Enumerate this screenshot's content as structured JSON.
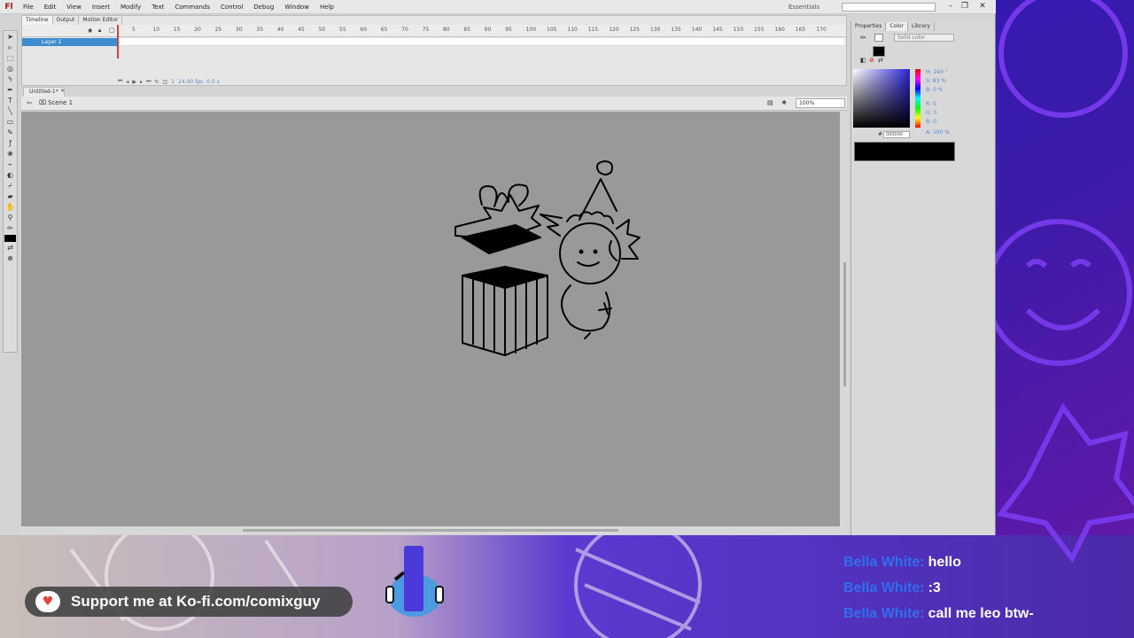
{
  "app": {
    "logo": "Fl",
    "menu": [
      "File",
      "Edit",
      "View",
      "Insert",
      "Modify",
      "Text",
      "Commands",
      "Control",
      "Debug",
      "Window",
      "Help"
    ],
    "workspace": "Essentials",
    "window_controls": [
      "–",
      "❐",
      "✕"
    ]
  },
  "timeline": {
    "tabs": [
      "Timeline",
      "Output",
      "Motion Editor"
    ],
    "frame_numbers": [
      "5",
      "10",
      "15",
      "20",
      "25",
      "30",
      "35",
      "40",
      "45",
      "50",
      "55",
      "60",
      "65",
      "70",
      "75",
      "80",
      "85",
      "90",
      "95",
      "100",
      "105",
      "110",
      "115",
      "120",
      "125",
      "130",
      "135",
      "140",
      "145",
      "150",
      "155",
      "160",
      "165",
      "170"
    ],
    "layer_name": "Layer 1",
    "fps": "24.00 fps",
    "time": "0.0 s",
    "frame": "1"
  },
  "document": {
    "tab_label": "Untitled-1*",
    "scene_label": "Scene 1",
    "zoom": "100%"
  },
  "right_panel": {
    "tabs": [
      "Properties",
      "Color",
      "Library"
    ],
    "fill_type": "Solid color",
    "hsb": [
      {
        "label": "H:",
        "value": "240 °"
      },
      {
        "label": "S:",
        "value": "83 %"
      },
      {
        "label": "B:",
        "value": "0 %"
      }
    ],
    "rgb": [
      {
        "label": "R:",
        "value": "0"
      },
      {
        "label": "G:",
        "value": "0"
      },
      {
        "label": "B:",
        "value": "0"
      }
    ],
    "alpha": {
      "label": "A:",
      "value": "100 %"
    },
    "hex": "000000"
  },
  "overlay": {
    "kofi_text": "Support me at Ko-fi.com/comixguy",
    "chat": [
      {
        "user": "Bella White:",
        "message": "hello"
      },
      {
        "user": "Bella White:",
        "message": ":3"
      },
      {
        "user": "Bella White:",
        "message": "call me leo btw-"
      }
    ]
  },
  "colors": {
    "accent_blue": "#3d8ed0",
    "chat_user": "#2f6ff0",
    "stage_gray": "#999999"
  }
}
